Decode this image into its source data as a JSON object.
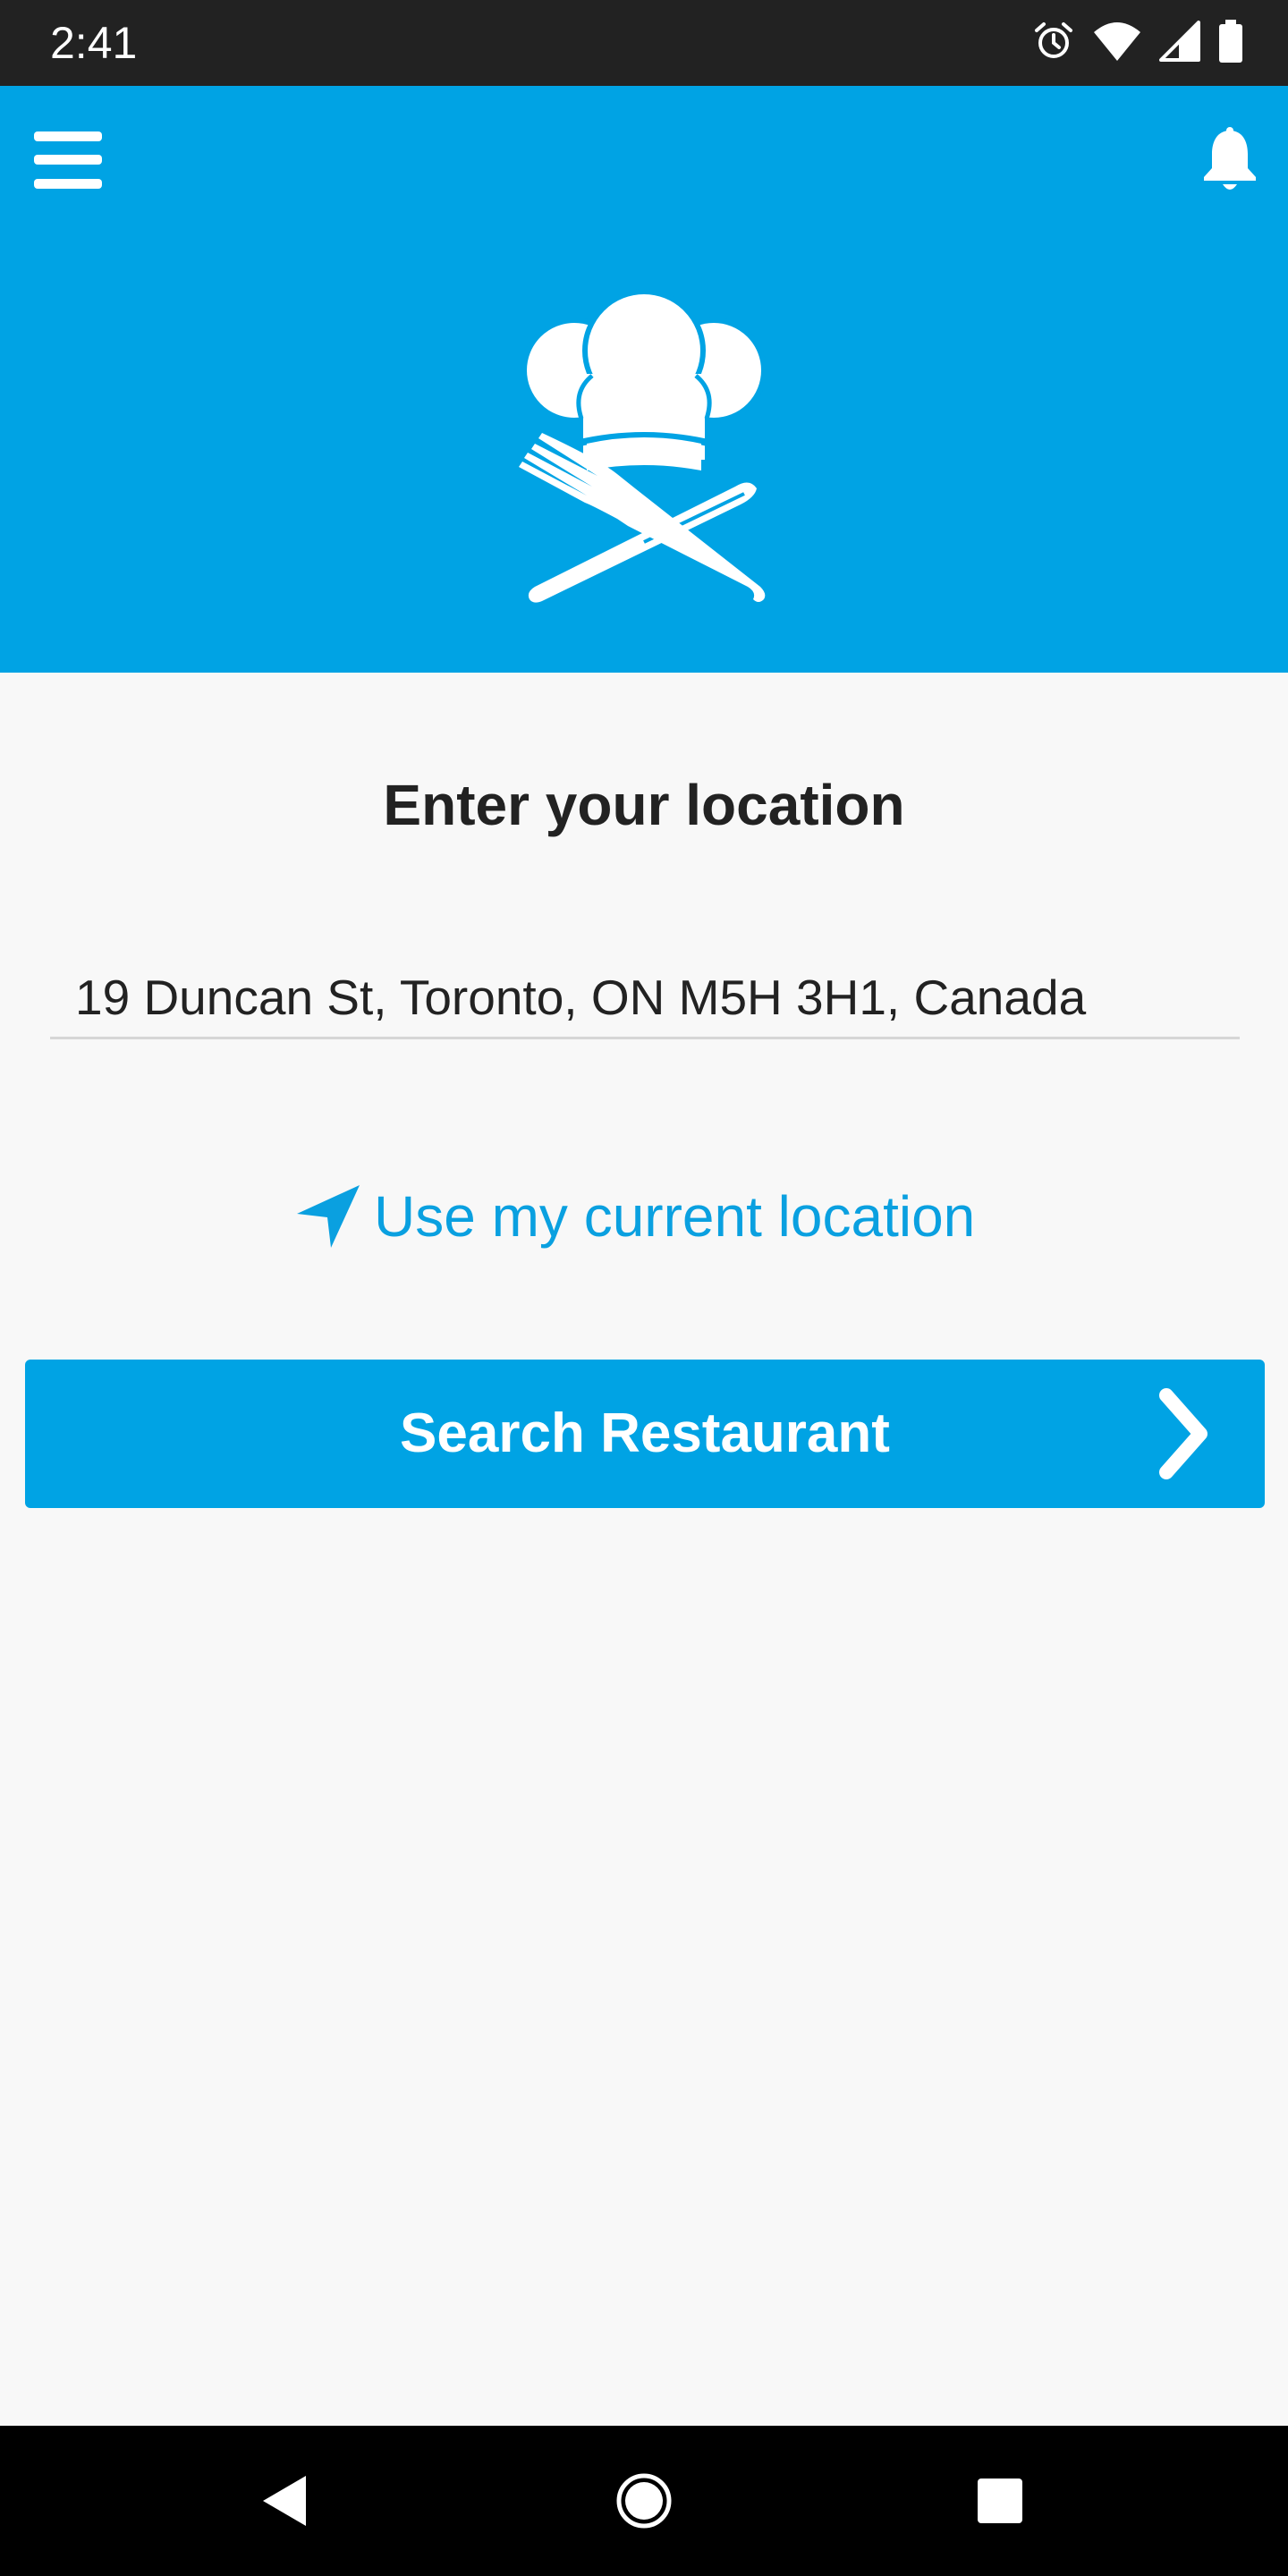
{
  "status_bar": {
    "time": "2:41",
    "icons": [
      "alarm-icon",
      "wifi-icon",
      "cell-signal-icon",
      "battery-icon"
    ]
  },
  "header": {
    "menu_icon": "menu-icon",
    "notification_icon": "bell-icon",
    "logo_icon": "chef-hat-cutlery-logo"
  },
  "main": {
    "title": "Enter your location",
    "location_value": "19 Duncan St, Toronto, ON M5H 3H1, Canada",
    "current_location_label": "Use my current location",
    "current_location_icon": "navigation-arrow-icon",
    "search_button_label": "Search Restaurant",
    "search_button_icon": "chevron-right-icon"
  },
  "nav_bar": {
    "icons": [
      "back-icon",
      "home-icon",
      "recents-icon"
    ]
  },
  "colors": {
    "brand": "#00a3e4",
    "link": "#0aa0e0",
    "status_bar": "#222222",
    "nav_bar": "#000000",
    "background": "#f8f8f8",
    "text": "#222222"
  }
}
